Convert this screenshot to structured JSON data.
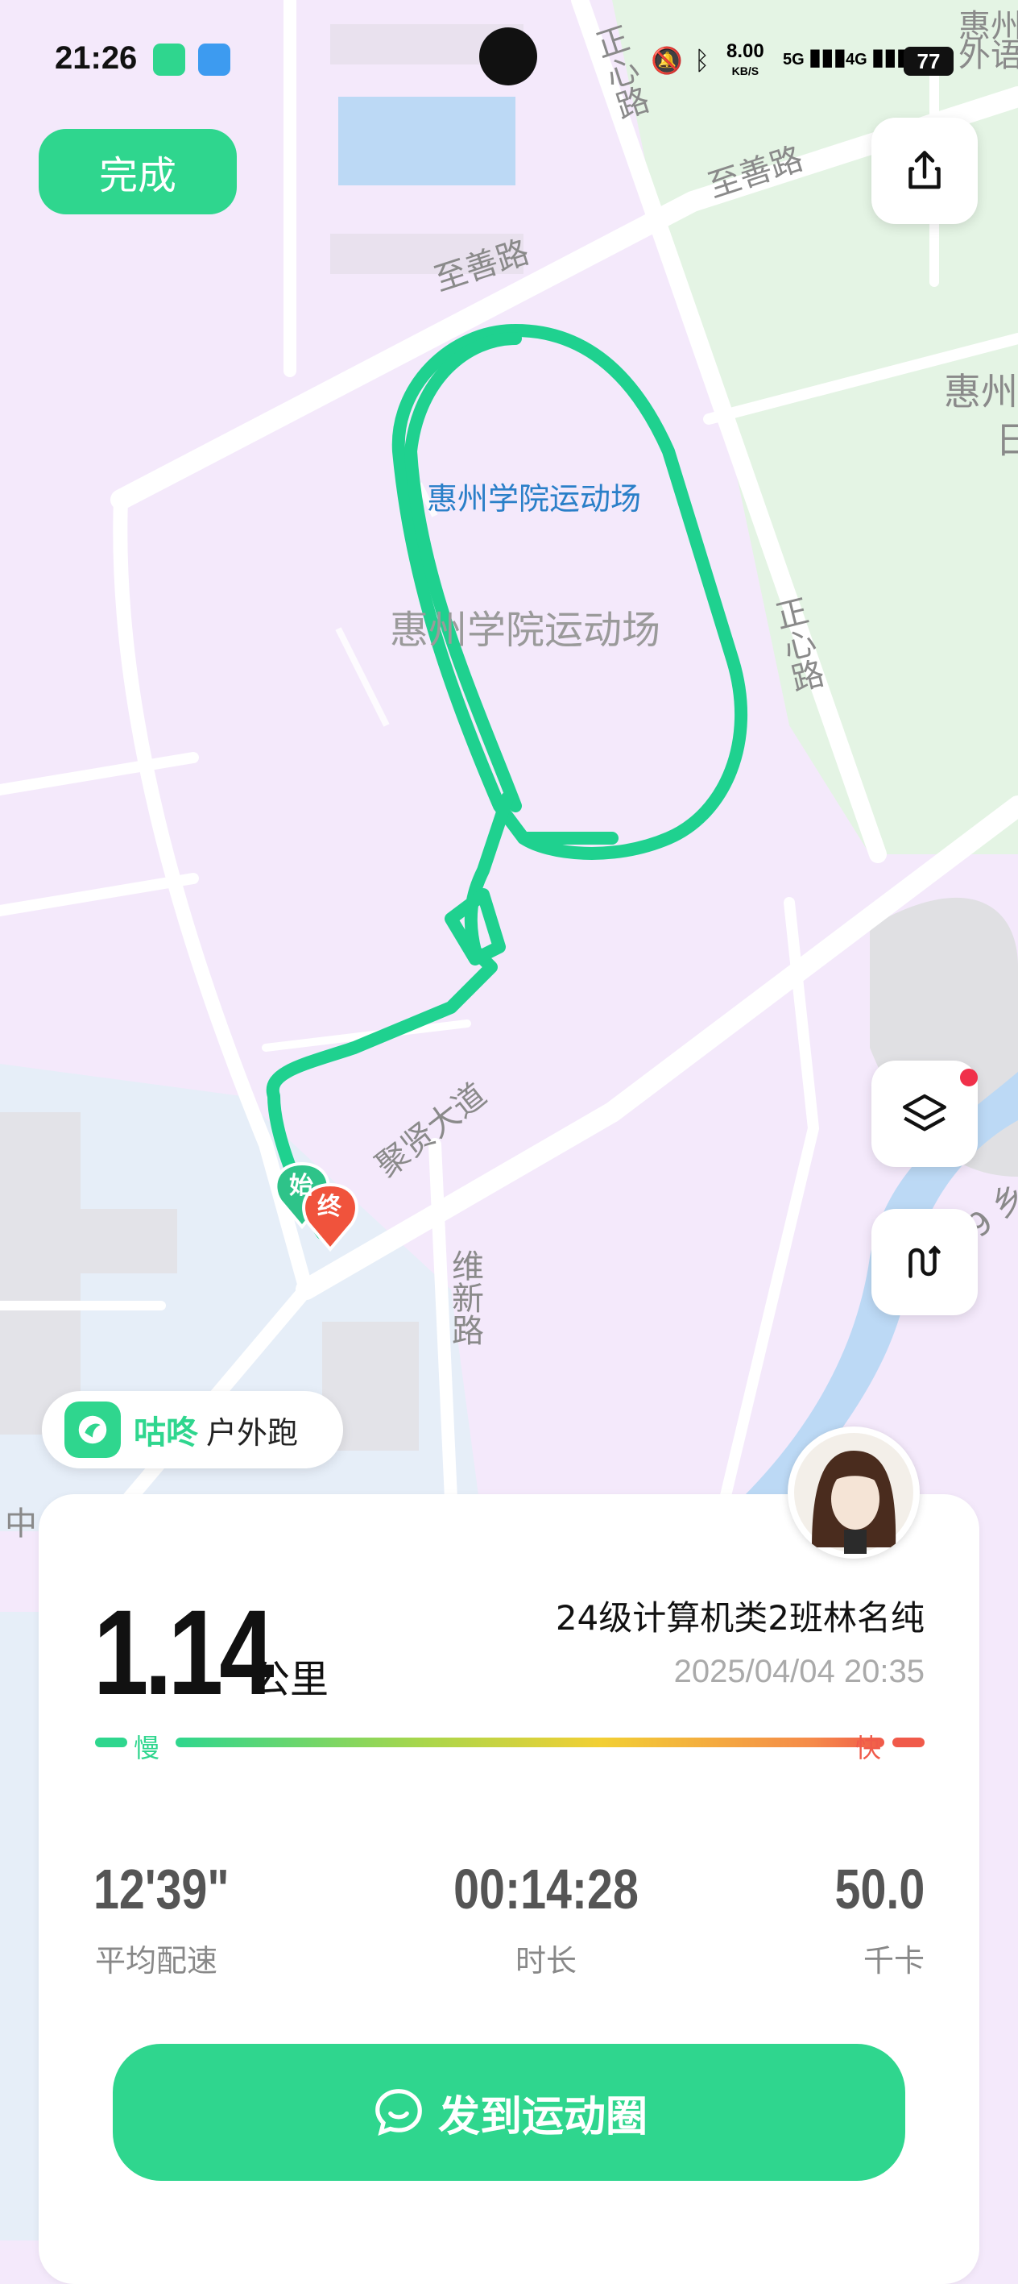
{
  "status_bar": {
    "time": "21:26",
    "network_speed": "8.00",
    "network_speed_unit": "KB/S",
    "signal_1": "5G",
    "signal_2": "4G",
    "battery": "77"
  },
  "map": {
    "venue_label": "惠州学院运动场",
    "venue_label_gray": "惠州学院运动场",
    "roads": {
      "zhishan_1": "至善路",
      "zhishan_2": "至善路",
      "zhengxin_1": "正心路",
      "zhengxin_2": "正心路",
      "juxian": "聚贤大道",
      "weixin": "维新路"
    },
    "other_labels": {
      "hui_top": "惠州",
      "wai_top": "外语",
      "hui_right": "惠州",
      "ri_right": "日",
      "zhong_left": "中",
      "water_right": "9 乡"
    },
    "start_marker": "始",
    "end_marker": "终"
  },
  "buttons": {
    "done": "完成",
    "share_post": "发到运动圈"
  },
  "brand": {
    "name": "咕咚",
    "activity": "户外跑"
  },
  "summary": {
    "distance": "1.14",
    "distance_unit": "公里",
    "user_name": "24级计算机类2班林名纯",
    "datetime": "2025/04/04 20:35",
    "slow_label": "慢",
    "fast_label": "快",
    "stats": [
      {
        "value": "12'39\"",
        "label": "平均配速"
      },
      {
        "value": "00:14:28",
        "label": "时长"
      },
      {
        "value": "50.0",
        "label": "千卡"
      }
    ]
  },
  "colors": {
    "accent": "#2fd68e",
    "route": "#1fd18f",
    "end_marker": "#f0533c",
    "map_bg": "#f4e9fb"
  }
}
